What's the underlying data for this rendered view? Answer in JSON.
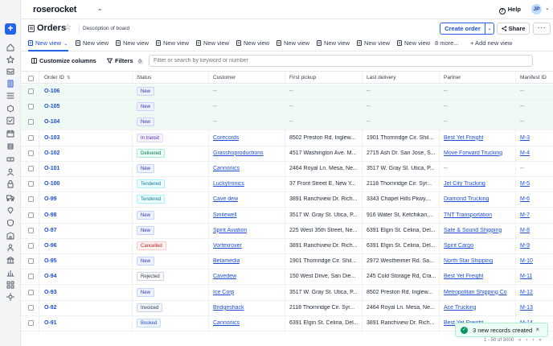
{
  "header": {
    "logo_text": "roserocket",
    "help_label": "Help",
    "avatar_initial": "JP"
  },
  "rail_icons": [
    "home-icon",
    "star-icon",
    "inbox-icon",
    "orders-icon",
    "list-icon",
    "box-icon",
    "check-icon",
    "calendar-icon",
    "database-icon",
    "money-icon",
    "user-icon",
    "lock-icon",
    "truck-icon",
    "map-pin-icon",
    "shield-icon",
    "building-icon",
    "person-icon",
    "bank-icon",
    "chart-icon",
    "grid-icon",
    "settings-icon",
    "globe-icon"
  ],
  "page": {
    "title": "Orders",
    "description": "Description of board",
    "create_label": "Create order",
    "share_label": "Share",
    "more_label": "···"
  },
  "tabs": {
    "items": [
      "New view",
      "New view",
      "New view",
      "New view",
      "New view",
      "New view",
      "New view",
      "New view",
      "New view",
      "New view"
    ],
    "more_label": "8 more...",
    "add_label": "+ Add new view"
  },
  "toolbar": {
    "customize_label": "Customize columns",
    "filters_label": "Filters",
    "filters_count": "0",
    "search_placeholder": "Filter or search by keyword or number"
  },
  "table": {
    "columns": [
      "Order ID",
      "Status",
      "Customer",
      "First pickup",
      "Last delivery",
      "Partner",
      "Manifest ID"
    ],
    "rows": [
      {
        "id": "O-106",
        "status": "New",
        "status_class": "st-new",
        "customer": "--",
        "pickup": "--",
        "delivery": "--",
        "partner": "--",
        "manifest": "--",
        "hl": true
      },
      {
        "id": "O-105",
        "status": "New",
        "status_class": "st-new",
        "customer": "--",
        "pickup": "--",
        "delivery": "--",
        "partner": "--",
        "manifest": "--",
        "hl": true
      },
      {
        "id": "O-104",
        "status": "New",
        "status_class": "st-new",
        "customer": "--",
        "pickup": "--",
        "delivery": "--",
        "partner": "--",
        "manifest": "--",
        "hl": true
      },
      {
        "id": "O-103",
        "status": "In transit",
        "status_class": "st-intransit",
        "customer": "Corecords",
        "pickup": "8502 Preston Rd. Inglew...",
        "delivery": "1901 Thornridge Cir. Shil...",
        "partner": "Best Yet Freight",
        "manifest": "M-3",
        "hl": false
      },
      {
        "id": "O-102",
        "status": "Delivered",
        "status_class": "st-delivered",
        "customer": "Grasshoproductions",
        "pickup": "4517 Washington Ave. M...",
        "delivery": "2715 Ash Dr. San Jose, S...",
        "partner": "Move Forward Trucking",
        "manifest": "M-4",
        "hl": false
      },
      {
        "id": "O-101",
        "status": "New",
        "status_class": "st-new",
        "customer": "Cannonics",
        "pickup": "2464 Royal Ln. Mesa, Ne...",
        "delivery": "3517 W. Gray St. Utica, P...",
        "partner": "--",
        "manifest": "--",
        "hl": false
      },
      {
        "id": "O-100",
        "status": "Tendered",
        "status_class": "st-tendered",
        "customer": "Luckytronics",
        "pickup": "37 Front Street E, New Y...",
        "delivery": "2118 Thornridge Cir. Syr...",
        "partner": "Jet City Trucking",
        "manifest": "M-5",
        "hl": false
      },
      {
        "id": "O-99",
        "status": "Tendered",
        "status_class": "st-tendered",
        "customer": "Cave dew",
        "pickup": "3891 Ranchview Dr. Rich...",
        "delivery": "3343 Chapel Hills Pkwy,...",
        "partner": "Diamond Trucking",
        "manifest": "M-6",
        "hl": false
      },
      {
        "id": "O-98",
        "status": "New",
        "status_class": "st-new",
        "customer": "Smilewell",
        "pickup": "3517 W. Gray St. Utica, P...",
        "delivery": "916 Water St, Ketchikan,...",
        "partner": "TNT Transportation",
        "manifest": "M-7",
        "hl": false
      },
      {
        "id": "O-97",
        "status": "New",
        "status_class": "st-new",
        "customer": "Spirit Aviation",
        "pickup": "225 West 35th Street, Ne...",
        "delivery": "6391 Elgin St. Celina, Del...",
        "partner": "Safe & Sound Shipping",
        "manifest": "M-8",
        "hl": false
      },
      {
        "id": "O-96",
        "status": "Cancelled",
        "status_class": "st-cancelled",
        "customer": "Vortexrover",
        "pickup": "3891 Ranchview Dr. Rich...",
        "delivery": "6391 Elgin St. Celina, Del...",
        "partner": "Spirit Cargo",
        "manifest": "M-9",
        "hl": false
      },
      {
        "id": "O-95",
        "status": "New",
        "status_class": "st-new",
        "customer": "Betamedia",
        "pickup": "1901 Thornridge Cir. Shil...",
        "delivery": "2972 Westheimer Rd. Sa...",
        "partner": "North Star Shipping",
        "manifest": "M-10",
        "hl": false
      },
      {
        "id": "O-94",
        "status": "Rejected",
        "status_class": "st-rejected",
        "customer": "Cavedew",
        "pickup": "150 West Drive, San Die...",
        "delivery": "245 Cold Storage Rd, Cra...",
        "partner": "Best Yet Freight",
        "manifest": "M-11",
        "hl": false
      },
      {
        "id": "O-93",
        "status": "New",
        "status_class": "st-new",
        "customer": "Ice Corp",
        "pickup": "3517 W. Gray St. Utica, P...",
        "delivery": "8502 Preston Rd. Inglew...",
        "partner": "Metropolitan Shipping Co",
        "manifest": "M-12",
        "hl": false
      },
      {
        "id": "O-92",
        "status": "Invoiced",
        "status_class": "st-invoiced",
        "customer": "Bridgeshack",
        "pickup": "2118 Thornridge Cir. Syr...",
        "delivery": "2464 Royal Ln. Mesa, Ne...",
        "partner": "Ace Trucking",
        "manifest": "M-13",
        "hl": false
      },
      {
        "id": "O-91",
        "status": "Booked",
        "status_class": "st-booked",
        "customer": "Cannonics",
        "pickup": "6391 Elgin St. Celina, Del...",
        "delivery": "3891 Ranchview Dr. Rich...",
        "partner": "Best Yet Freight",
        "manifest": "M-14",
        "hl": false
      }
    ]
  },
  "pager": {
    "range_label": "1 - 50 of 3000"
  },
  "toast": {
    "message": "3 new records created"
  }
}
